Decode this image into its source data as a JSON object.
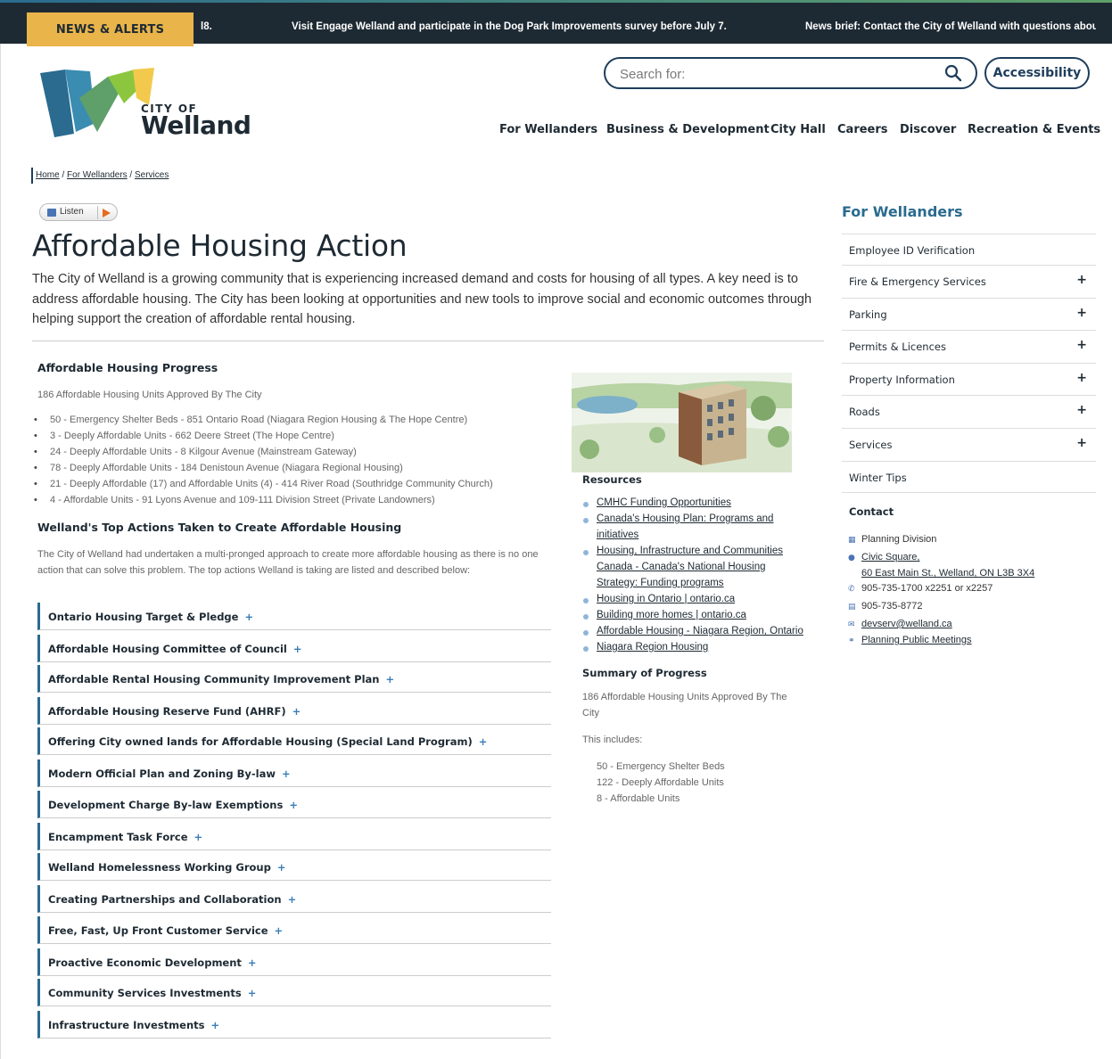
{
  "alerts": {
    "label": "NEWS & ALERTS",
    "items": [
      "l8.",
      "Visit Engage Welland and participate in the Dog Park Improvements survey before July 7.",
      "News brief: Contact the City of Welland with questions abou"
    ]
  },
  "logo": {
    "small": "CITY OF",
    "big": "Welland"
  },
  "search": {
    "placeholder": "Search for:"
  },
  "accessibility": "Accessibility",
  "nav": [
    "For Wellanders",
    "Business & Development",
    "City Hall",
    "Careers",
    "Discover",
    "Recreation & Events"
  ],
  "breadcrumb": [
    "Home",
    "For Wellanders",
    "Services"
  ],
  "listen": "Listen",
  "page": {
    "title": "Affordable Housing Action",
    "intro": "The City of Welland is a growing community that is experiencing increased demand and costs for housing of all types. A key need is to address affordable housing. The City has been looking at opportunities and new tools to improve social and economic outcomes through helping support the creation of affordable rental housing."
  },
  "progress": {
    "heading": "Affordable Housing Progress",
    "subtitle": "186 Affordable Housing Units Approved By The City",
    "items": [
      "50 - Emergency Shelter Beds - 851 Ontario Road (Niagara Region Housing & The Hope Centre)",
      "3 - Deeply Affordable Units - 662 Deere Street (The Hope Centre)",
      "24 - Deeply Affordable Units - 8 Kilgour Avenue (Mainstream Gateway)",
      "78 - Deeply Affordable Units - 184 Denistoun Avenue (Niagara Regional Housing)",
      "21 - Deeply Affordable (17) and Affordable Units (4) - 414 River Road (Southridge Community Church)",
      "4 - Affordable Units - 91 Lyons Avenue and 109-111 Division Street (Private Landowners)"
    ]
  },
  "actions": {
    "heading": "Welland's Top Actions Taken to Create Affordable Housing",
    "desc": "The City of Welland had undertaken a multi-pronged approach to create more affordable housing as there is no one action that can solve this problem. The top actions Welland is taking are listed and described below:",
    "items": [
      "Ontario Housing Target & Pledge",
      "Affordable Housing Committee of Council",
      "Affordable Rental Housing Community Improvement Plan",
      "Affordable Housing Reserve Fund (AHRF)",
      "Offering City owned lands for Affordable Housing (Special Land Program)",
      "Modern Official Plan and Zoning By-law",
      "Development Charge By-law Exemptions",
      "Encampment Task Force",
      "Welland Homelessness Working Group",
      "Creating Partnerships and Collaboration",
      "Free, Fast, Up Front Customer Service",
      "Proactive Economic Development",
      "Community Services Investments",
      "Infrastructure Investments"
    ],
    "plus": "+"
  },
  "resources": {
    "heading": "Resources",
    "links": [
      [
        "CMHC Funding Opportunities"
      ],
      [
        "Canada's Housing Plan: Programs and",
        "initiatives"
      ],
      [
        "Housing, Infrastructure and Communities",
        "Canada - Canada's National Housing",
        "Strategy: Funding programs"
      ],
      [
        "Housing in Ontario | ontario.ca"
      ],
      [
        "Building more homes | ontario.ca"
      ],
      [
        "Affordable Housing - Niagara Region, Ontario"
      ],
      [
        "Niagara Region Housing"
      ]
    ]
  },
  "summary": {
    "heading": "Summary of Progress",
    "line1": "186 Affordable Housing Units Approved By The",
    "line2": "City",
    "includes": "This includes:",
    "items": [
      "50 - Emergency Shelter Beds",
      "122 - Deeply Affordable Units",
      "8 - Affordable Units"
    ]
  },
  "sidebar": {
    "title": "For Wellanders",
    "items": [
      {
        "label": "Employee ID Verification",
        "plus": ""
      },
      {
        "label": "Fire & Emergency Services",
        "plus": "+"
      },
      {
        "label": "Parking",
        "plus": "+"
      },
      {
        "label": "Permits & Licences",
        "plus": "+"
      },
      {
        "label": "Property Information",
        "plus": "+"
      },
      {
        "label": "Roads",
        "plus": "+"
      },
      {
        "label": "Services",
        "plus": "+"
      },
      {
        "label": "Winter Tips",
        "plus": ""
      }
    ],
    "contact": {
      "heading": "Contact",
      "division": "Planning Division",
      "place": "Civic Square,",
      "address": "60 East Main St., Welland, ON L3B 3X4",
      "phone": "905-735-1700 x2251 or x2257",
      "fax": "905-735-8772",
      "email": "devserv@welland.ca",
      "meetings": "Planning Public Meetings"
    }
  },
  "colors": {
    "alert_bar": "#1e2a33",
    "alert_label": "#e9b44a",
    "brand_blue": "#2a6b8f",
    "brand_green": "#8cc63f",
    "brand_yellow": "#f2c94c"
  }
}
